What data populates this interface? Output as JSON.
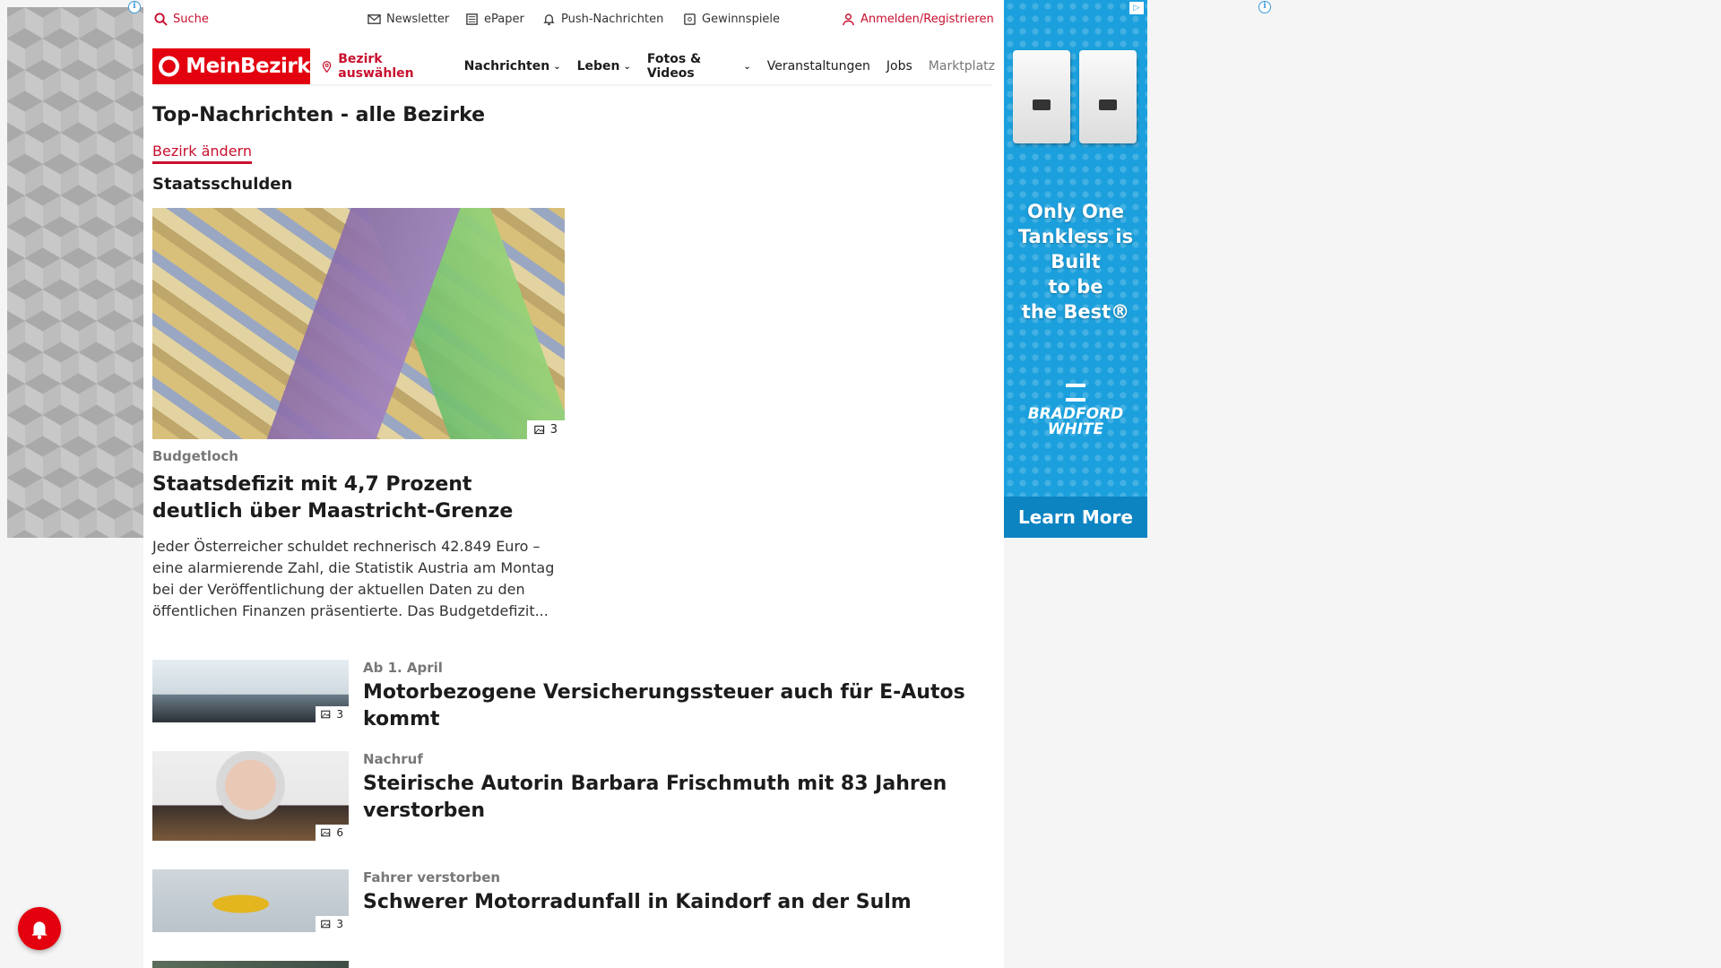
{
  "topbar": {
    "search_label": "Suche",
    "newsletter_label": "Newsletter",
    "epaper_label": "ePaper",
    "push_label": "Push-Nachrichten",
    "gewinnspiele_label": "Gewinnspiele",
    "login_label": "Anmelden/Registrieren"
  },
  "nav": {
    "logo_text": "MeinBezirk",
    "bezirk_select": "Bezirk auswählen",
    "items": [
      {
        "label": "Nachrichten"
      },
      {
        "label": "Leben"
      },
      {
        "label": "Fotos & Videos"
      },
      {
        "label": "Veranstaltungen"
      },
      {
        "label": "Jobs"
      },
      {
        "label": "Marktplatz"
      }
    ]
  },
  "page": {
    "title": "Top-Nachrichten - alle Bezirke",
    "change_link": "Bezirk ändern",
    "section_title": "Staatsschulden"
  },
  "hero": {
    "photo_count": "3",
    "kicker": "Budgetloch",
    "title": "Staatsdefizit mit 4,7 Prozent deutlich über Maastricht-Grenze",
    "teaser": "Jeder Österreicher schuldet rechnerisch 42.849 Euro – eine alarmierende Zahl, die Statistik Austria am Montag bei der Veröffentlichung der aktuellen Daten zu den öffentlichen Finanzen präsentierte. Das Budgetdefizit..."
  },
  "articles": [
    {
      "kicker": "Ab 1. April",
      "title": "Motorbezogene Versicherungssteuer auch für E-Autos kommt",
      "photo_count": "3"
    },
    {
      "kicker": "Nachruf",
      "title": "Steirische Autorin Barbara Frischmuth mit 83 Jahren verstorben",
      "photo_count": "6"
    },
    {
      "kicker": "Fahrer verstorben",
      "title": "Schwerer Motorradunfall in Kaindorf an der Sulm",
      "photo_count": "3"
    }
  ],
  "right_ad": {
    "headline_lines": [
      "Only One",
      "Tankless is",
      "Built",
      "to be",
      "the Best®"
    ],
    "brand_line1": "BRADFORD",
    "brand_line2": "WHITE",
    "cta": "Learn More",
    "choices_icon": "ad-choices-icon"
  },
  "colors": {
    "brand_red": "#e3000f",
    "link_red": "#c8102e",
    "ad_blue": "#1ba0dd"
  }
}
